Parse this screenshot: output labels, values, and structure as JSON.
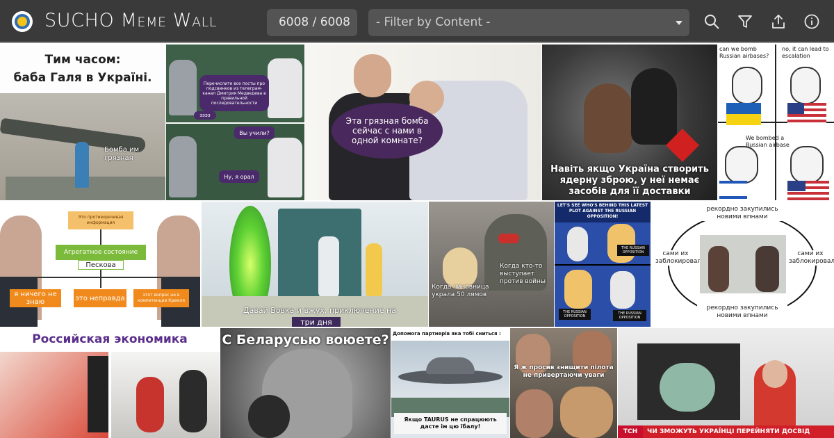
{
  "app": {
    "title": "SUCHO Meme Wall",
    "count_display": "6008 / 6008",
    "filter_placeholder": "- Filter by Content -",
    "colors": {
      "header_bg": "#3a3a3a",
      "control_bg": "#545454",
      "logo_blue": "#2f6db5",
      "logo_yellow": "#f3c318"
    },
    "icons": [
      "search-icon",
      "filter-icon",
      "share-icon",
      "info-icon"
    ]
  },
  "memes": {
    "m1": {
      "line1": "Тим часом:",
      "line2": "баба Галя в Україні.",
      "label": "Бомба им\nгрязная"
    },
    "m2": {
      "bubble1": "Перечислите все посты про подсвинков из телеграм-канал Дмитрия Медведева в правильной последовательности",
      "reply1": "ээээ",
      "bubble2": "Вы учили?",
      "reply2": "Ну, я орал"
    },
    "m3": {
      "bubble": "Эта грязная бомба сейчас с нами в одной комнате?"
    },
    "m4": {
      "caption": "Навіть якщо Україна створить ядерну зброю, у неї немає засобів для її доставки"
    },
    "m5": {
      "q1": "can we bomb Russian airbases?",
      "a1": "no, it can lead to escalation",
      "q2": "We bombed a Russian airbase"
    },
    "m6": {
      "top": "Это противоречивая информация",
      "center_top": "Агрегатное состояние",
      "center_name": "Пескова",
      "opt1": "я ничего не знаю",
      "opt2": "это неправда",
      "opt3": "этот вопрос не в компетенции Кремля"
    },
    "m7": {
      "subtitle": "Давай Вовка и вжух, приключение на",
      "highlight": "три дня"
    },
    "m8": {
      "label1": "Когда кто-то выступает против войны",
      "label2": "Когда чиновница украла 50 лямов"
    },
    "m9": {
      "title": "LET'S SEE WHO'S BEHIND THIS LATEST PLOT AGAINST THE RUSSIAN OPPOSITION!",
      "tag": "THE RUSSIAN OPPOSITION"
    },
    "m10": {
      "top": "рекордно закупились новими впнами",
      "bottom": "рекордно закупились новими впнами",
      "left": "сами их заблокировали",
      "right": "сами их заблокировали"
    },
    "m11": {
      "title": "Российская экономика"
    },
    "m12": {
      "caption": "С Беларусью воюете?"
    },
    "m13": {
      "top": "Допомога партнерів яка тобі сниться :",
      "bottom": "Якщо TAURUS не спрацюють дасте ім цю їбалу!"
    },
    "m14": {
      "caption": "Я ж просив знищити пілота не привертаючи уваги"
    },
    "m15": {
      "ticker": "ЧИ ЗМОЖУТЬ УКРАЇНЦІ ПЕРЕЙНЯТИ ДОСВІД",
      "channel": "ТСН"
    }
  }
}
